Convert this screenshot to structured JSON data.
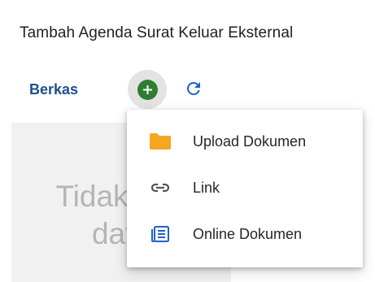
{
  "window": {
    "title": "Tambah Agenda Surat Keluar Eksternal"
  },
  "toolbar": {
    "section_label": "Berkas",
    "add_icon": "add-circle-icon",
    "refresh_icon": "refresh-icon"
  },
  "attachments": {
    "empty_text_line1": "Tidak ada",
    "empty_text_line2": "data"
  },
  "add_menu": {
    "items": [
      {
        "label": "Upload Dokumen",
        "icon": "folder-icon",
        "color": "#f5a623"
      },
      {
        "label": "Link",
        "icon": "link-icon",
        "color": "#555555"
      },
      {
        "label": "Online Dokumen",
        "icon": "online-document-icon",
        "color": "#1e62c9"
      }
    ]
  },
  "colors": {
    "accent_blue": "#1e62c9",
    "add_green": "#2e7d32",
    "label_blue": "#1f4e8c"
  }
}
